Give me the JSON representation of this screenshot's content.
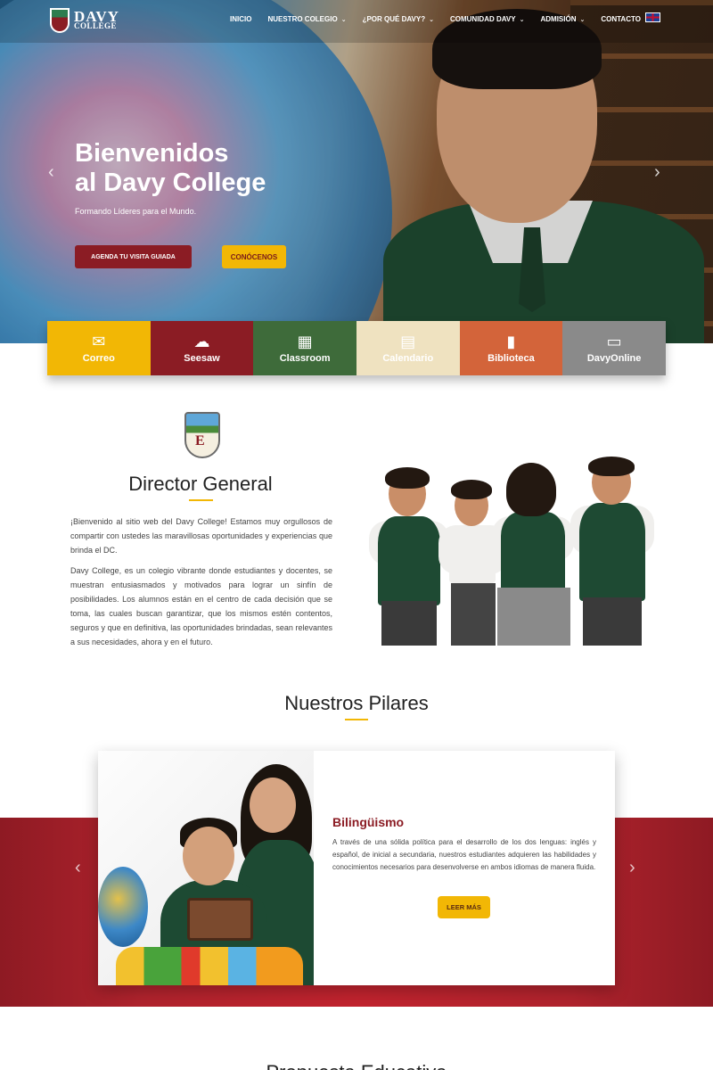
{
  "brand": {
    "line1": "DAVY",
    "line2": "COLLEGE"
  },
  "nav": {
    "items": [
      {
        "label": "INICIO",
        "dropdown": false
      },
      {
        "label": "NUESTRO COLEGIO",
        "dropdown": true
      },
      {
        "label": "¿POR QUÉ DAVY?",
        "dropdown": true
      },
      {
        "label": "COMUNIDAD DAVY",
        "dropdown": true
      },
      {
        "label": "ADMISIÓN",
        "dropdown": true
      },
      {
        "label": "CONTACTO",
        "dropdown": true
      }
    ],
    "language_icon": "uk-flag-icon"
  },
  "hero": {
    "title_line1": "Bienvenidos",
    "title_line2": "al Davy College",
    "subtitle": "Formando Líderes para el Mundo.",
    "cta_primary": "AGENDA TU VISITA GUIADA",
    "cta_secondary": "CONÓCENOS"
  },
  "tiles": [
    {
      "label": "Correo",
      "icon": "mail-icon",
      "color": "#f2b705"
    },
    {
      "label": "Seesaw",
      "icon": "cloud-icon",
      "color": "#8b1c24"
    },
    {
      "label": "Classroom",
      "icon": "classroom-icon",
      "color": "#3e6b3a"
    },
    {
      "label": "Calendario",
      "icon": "calendar-icon",
      "color": "#efe2c0"
    },
    {
      "label": "Biblioteca",
      "icon": "book-icon",
      "color": "#d3643a"
    },
    {
      "label": "DavyOnline",
      "icon": "laptop-icon",
      "color": "#8a8a8a"
    }
  ],
  "director": {
    "title": "Director General",
    "paragraph1": "¡Bienvenido al sitio web del Davy College! Estamos muy orgullosos de compartir con ustedes las maravillosas oportunidades y experiencias que brinda el DC.",
    "paragraph2": "Davy College, es un colegio vibrante donde estudiantes y docentes, se muestran entusiasmados y motivados para lograr un sinfín de posibilidades. Los alumnos están en el centro de cada decisión que se toma, las cuales buscan garantizar, que los mismos estén contentos, seguros y que en definitiva, las oportunidades brindadas, sean relevantes a sus necesidades, ahora y en el futuro."
  },
  "pilares": {
    "title": "Nuestros Pilares",
    "card_title": "Bilingüismo",
    "card_text": "A través de una sólida política para el desarrollo de los dos lenguas: inglés y español, de inicial a secundaria, nuestros estudiantes adquieren las habilidades y conocimientos necesarios para desenvolverse en ambos idiomas de manera fluida.",
    "card_button": "LEER MÁS"
  },
  "next_section": {
    "title": "Propuesta Educativa"
  },
  "colors": {
    "brand_red": "#8b1c24",
    "brand_yellow": "#f2b705",
    "brand_green": "#1e4a33"
  }
}
